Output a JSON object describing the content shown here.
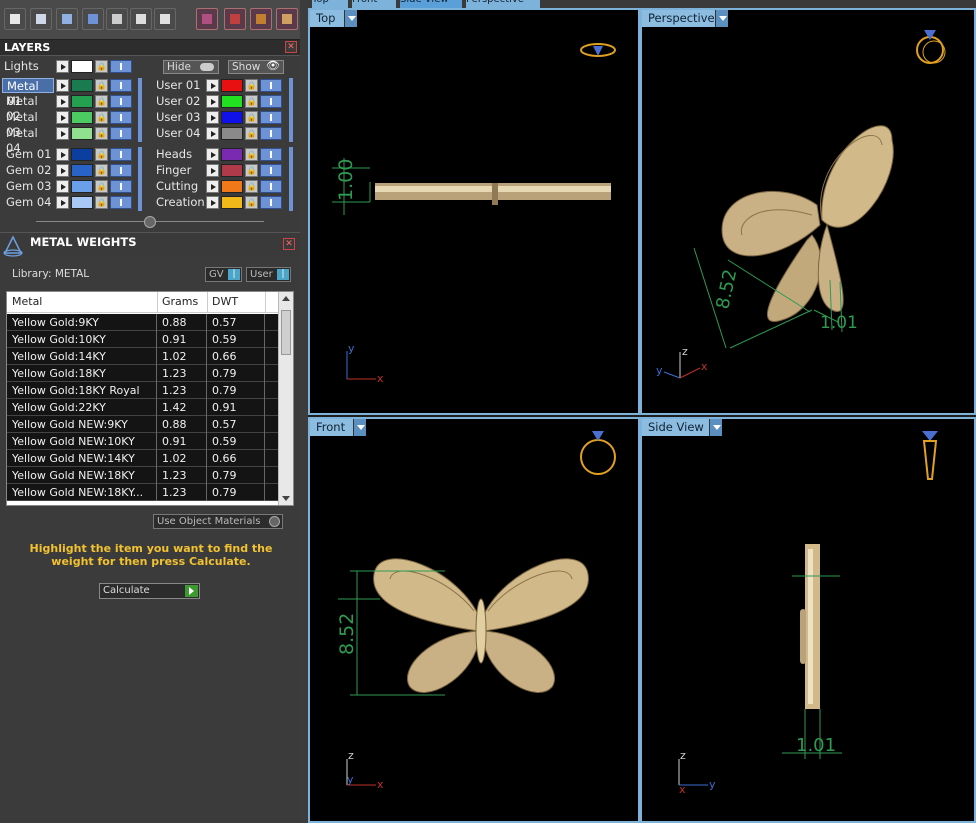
{
  "toolbar": {
    "icons": [
      "layout-icon",
      "monitor-icon",
      "cube-icon",
      "box-icon",
      "filter-icon",
      "select-icon",
      "list-icon",
      "ring-icon",
      "grid-icon",
      "gear-icon",
      "settings-icon"
    ]
  },
  "layers": {
    "title": "LAYERS",
    "lights_label": "Lights",
    "hide_label": "Hide",
    "show_label": "Show",
    "metal": [
      {
        "name": "Metal 01",
        "color": "#1a7a50"
      },
      {
        "name": "Metal 02",
        "color": "#23a050"
      },
      {
        "name": "Metal 03",
        "color": "#4ccb62"
      },
      {
        "name": "Metal 04",
        "color": "#8fe08f"
      }
    ],
    "user": [
      {
        "name": "User 01",
        "color": "#e81010"
      },
      {
        "name": "User 02",
        "color": "#20e020"
      },
      {
        "name": "User 03",
        "color": "#1010e8"
      },
      {
        "name": "User 04",
        "color": "#8a8a8a"
      }
    ],
    "gem": [
      {
        "name": "Gem 01",
        "color": "#0a3fa0"
      },
      {
        "name": "Gem 02",
        "color": "#2a63c8"
      },
      {
        "name": "Gem 03",
        "color": "#6aa0ea"
      },
      {
        "name": "Gem 04",
        "color": "#a8c8f5"
      }
    ],
    "other": [
      {
        "name": "Heads",
        "color": "#7a2ab0"
      },
      {
        "name": "Finger",
        "color": "#b03a4a"
      },
      {
        "name": "Cutting",
        "color": "#f07818"
      },
      {
        "name": "Creation",
        "color": "#f0b818"
      }
    ]
  },
  "metal_weights": {
    "title": "METAL WEIGHTS",
    "library": "Library: METAL",
    "gv_label": "GV",
    "user_label": "User",
    "columns": [
      "Metal",
      "Grams",
      "DWT"
    ],
    "rows": [
      [
        "Yellow Gold:9KY",
        "0.88",
        "0.57"
      ],
      [
        "Yellow Gold:10KY",
        "0.91",
        "0.59"
      ],
      [
        "Yellow Gold:14KY",
        "1.02",
        "0.66"
      ],
      [
        "Yellow Gold:18KY",
        "1.23",
        "0.79"
      ],
      [
        "Yellow Gold:18KY Royal",
        "1.23",
        "0.79"
      ],
      [
        "Yellow Gold:22KY",
        "1.42",
        "0.91"
      ],
      [
        "Yellow Gold NEW:9KY",
        "0.88",
        "0.57"
      ],
      [
        "Yellow Gold NEW:10KY",
        "0.91",
        "0.59"
      ],
      [
        "Yellow Gold NEW:14KY",
        "1.02",
        "0.66"
      ],
      [
        "Yellow Gold NEW:18KY",
        "1.23",
        "0.79"
      ],
      [
        "Yellow Gold NEW:18KY...",
        "1.23",
        "0.79"
      ]
    ],
    "use_object_materials": "Use Object Materials",
    "hint": "Highlight the item you want to find the weight for then press Calculate.",
    "calculate_label": "Calculate"
  },
  "view_tabs": [
    "Top",
    "Front",
    "Side View",
    "Perspective"
  ],
  "viewports": {
    "top": {
      "label": "Top",
      "dim": "1.00",
      "axis_a": "y",
      "axis_b": "x"
    },
    "perspective": {
      "label": "Perspective",
      "dim1": "8.52",
      "dim2": "1.01",
      "axis_a": "z",
      "axis_b": "y",
      "axis_c": "x"
    },
    "front": {
      "label": "Front",
      "dim": "8.52",
      "axis_a": "z",
      "axis_b": "y",
      "axis_c": "x"
    },
    "side": {
      "label": "Side View",
      "dim": "1.01",
      "axis_a": "z",
      "axis_b": "x",
      "axis_c": "y"
    }
  },
  "colors": {
    "viewport_border": "#7db3da",
    "dimension": "#2e9a52",
    "gold": "#d2b98a",
    "axis_x": "#c0302a",
    "axis_y": "#3a6fd0",
    "axis_z": "#d0d0d0"
  }
}
